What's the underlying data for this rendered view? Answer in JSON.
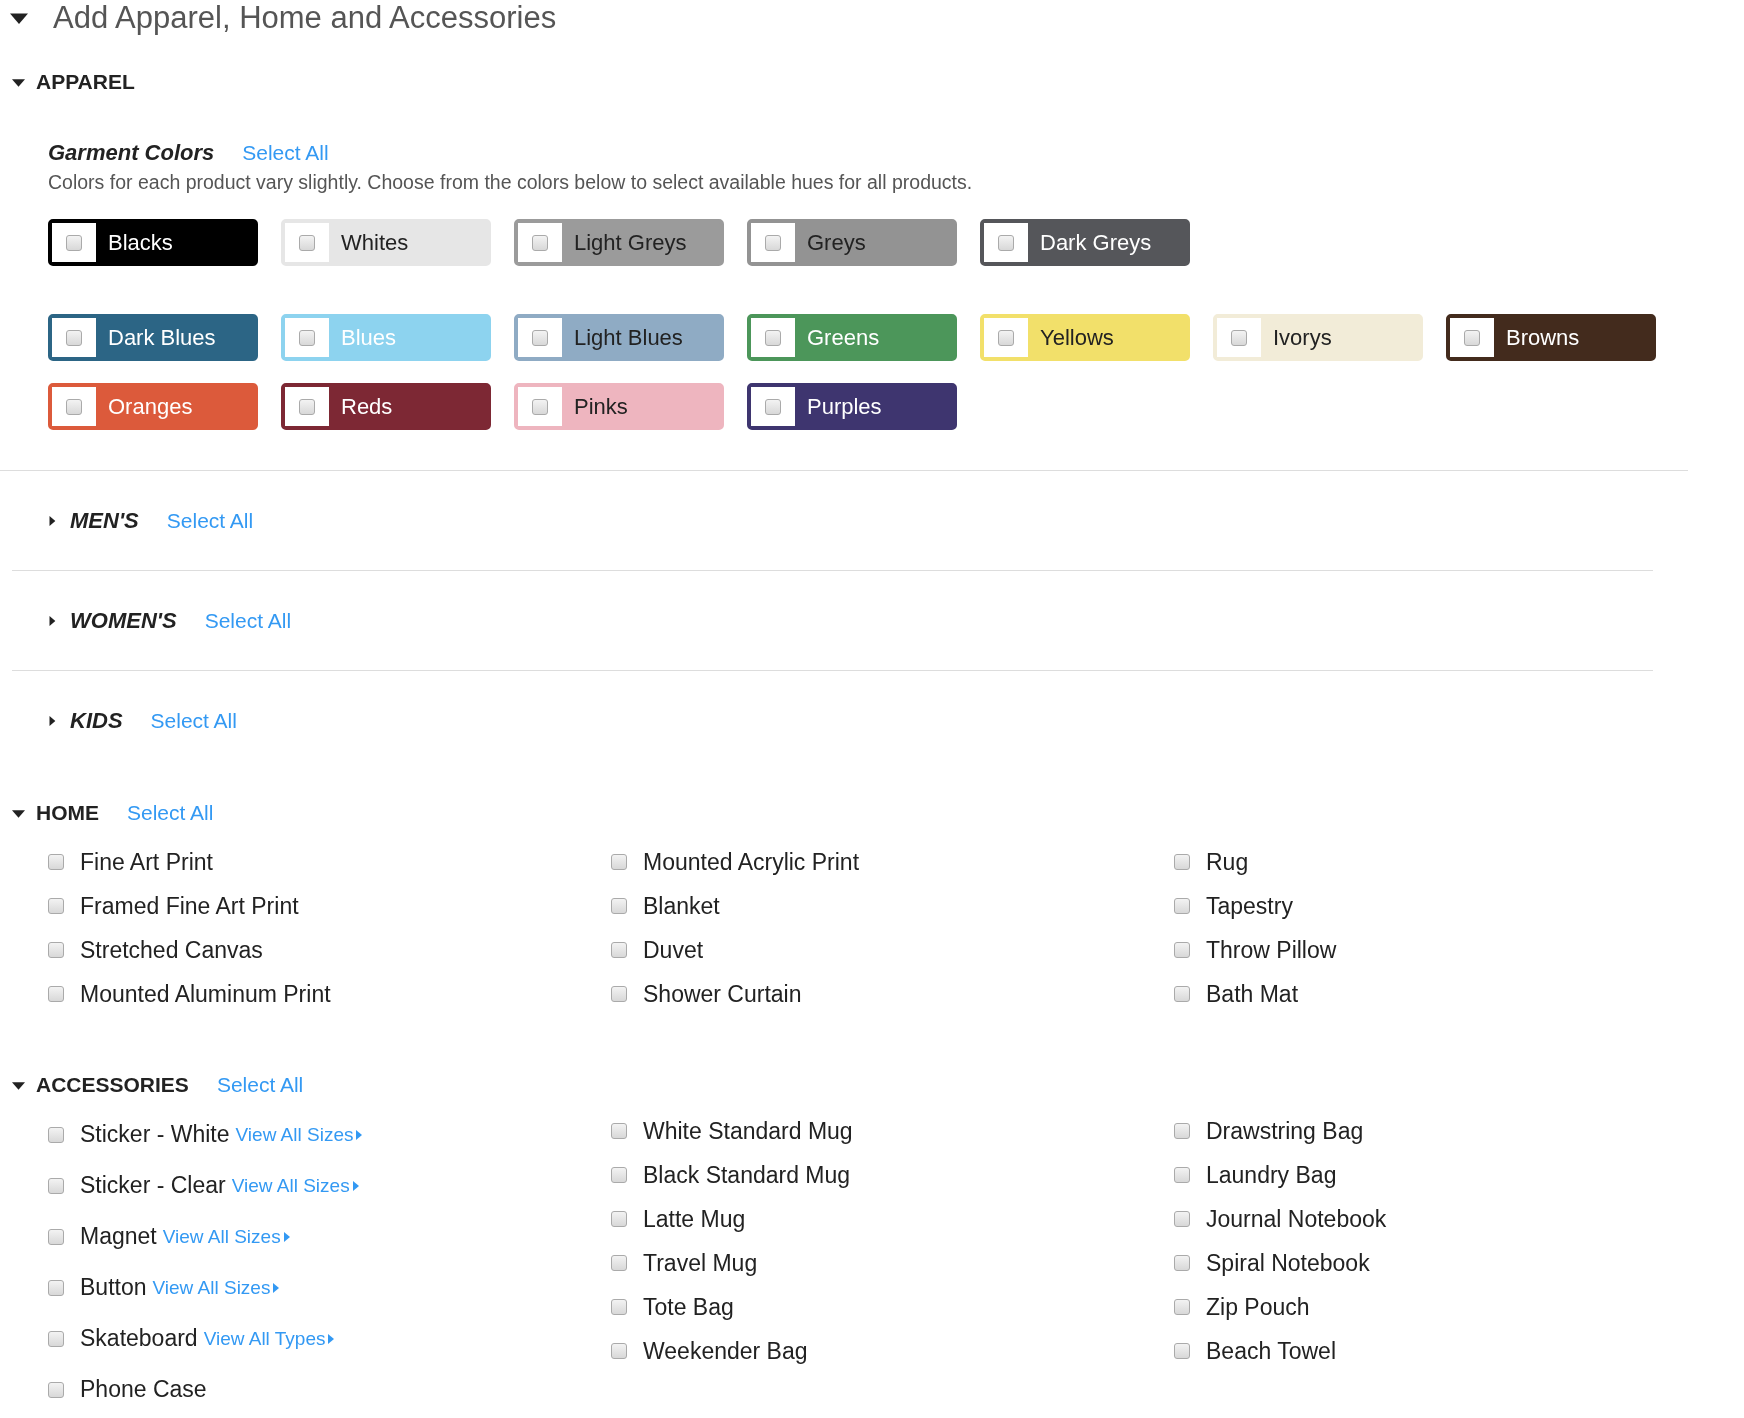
{
  "title": {
    "text": "Add Apparel, Home and Accessories",
    "expanded": true
  },
  "apparel": {
    "heading": "APPAREL",
    "expanded": true,
    "garment_colors": {
      "heading": "Garment Colors",
      "select_all": "Select All",
      "description": "Colors for each product vary slightly. Choose from the colors below to select available hues for all products.",
      "rows": [
        [
          {
            "label": "Blacks",
            "color": "#000000",
            "kind": "light",
            "checked": false
          },
          {
            "label": "Whites",
            "color": "#e6e6e6",
            "kind": "dark",
            "checked": false
          },
          {
            "label": "Light Greys",
            "color": "#9b9b9b",
            "kind": "dark",
            "checked": false
          },
          {
            "label": "Greys",
            "color": "#939393",
            "kind": "dark",
            "checked": false
          },
          {
            "label": "Dark Greys",
            "color": "#55565a",
            "kind": "light",
            "checked": false
          }
        ],
        [
          {
            "label": "Dark Blues",
            "color": "#2c6585",
            "kind": "light",
            "checked": false
          },
          {
            "label": "Blues",
            "color": "#8dd3ef",
            "kind": "light",
            "checked": false
          },
          {
            "label": "Light Blues",
            "color": "#8fabc4",
            "kind": "dark",
            "checked": false
          },
          {
            "label": "Greens",
            "color": "#4c965a",
            "kind": "light",
            "checked": false
          },
          {
            "label": "Yellows",
            "color": "#f2e06a",
            "kind": "dark",
            "checked": false
          },
          {
            "label": "Ivorys",
            "color": "#f2ecd8",
            "kind": "dark",
            "checked": false
          },
          {
            "label": "Browns",
            "color": "#432b1d",
            "kind": "light",
            "checked": false
          }
        ],
        [
          {
            "label": "Oranges",
            "color": "#dc5a3b",
            "kind": "light",
            "checked": false
          },
          {
            "label": "Reds",
            "color": "#7d2834",
            "kind": "light",
            "checked": false
          },
          {
            "label": "Pinks",
            "color": "#eeb5bf",
            "kind": "dark",
            "checked": false
          },
          {
            "label": "Purples",
            "color": "#3e356f",
            "kind": "light",
            "checked": false
          }
        ]
      ]
    },
    "subsections": [
      {
        "heading": "MEN'S",
        "select_all": "Select All",
        "expanded": false
      },
      {
        "heading": "WOMEN'S",
        "select_all": "Select All",
        "expanded": false
      },
      {
        "heading": "KIDS",
        "select_all": "Select All",
        "expanded": false
      }
    ]
  },
  "home": {
    "heading": "HOME",
    "select_all": "Select All",
    "expanded": true,
    "columns": [
      [
        {
          "label": "Fine Art Print",
          "checked": false
        },
        {
          "label": "Framed Fine Art Print",
          "checked": false
        },
        {
          "label": "Stretched Canvas",
          "checked": false
        },
        {
          "label": "Mounted Aluminum Print",
          "checked": false
        }
      ],
      [
        {
          "label": "Mounted Acrylic Print",
          "checked": false
        },
        {
          "label": "Blanket",
          "checked": false
        },
        {
          "label": "Duvet",
          "checked": false
        },
        {
          "label": "Shower Curtain",
          "checked": false
        }
      ],
      [
        {
          "label": "Rug",
          "checked": false
        },
        {
          "label": "Tapestry",
          "checked": false
        },
        {
          "label": "Throw Pillow",
          "checked": false
        },
        {
          "label": "Bath Mat",
          "checked": false
        }
      ]
    ]
  },
  "accessories": {
    "heading": "ACCESSORIES",
    "select_all": "Select All",
    "expanded": true,
    "columns": [
      [
        {
          "label": "Sticker - White",
          "link": "View All Sizes",
          "checked": false
        },
        {
          "label": "Sticker - Clear",
          "link": "View All Sizes",
          "checked": false
        },
        {
          "label": "Magnet",
          "link": "View All Sizes",
          "checked": false
        },
        {
          "label": "Button",
          "link": "View All Sizes",
          "checked": false
        },
        {
          "label": "Skateboard",
          "link": "View All Types",
          "checked": false
        },
        {
          "label": "Phone Case",
          "checked": false
        }
      ],
      [
        {
          "label": "White Standard Mug",
          "checked": false
        },
        {
          "label": "Black Standard Mug",
          "checked": false
        },
        {
          "label": "Latte Mug",
          "checked": false
        },
        {
          "label": "Travel Mug",
          "checked": false
        },
        {
          "label": "Tote Bag",
          "checked": false
        },
        {
          "label": "Weekender Bag",
          "checked": false
        }
      ],
      [
        {
          "label": "Drawstring Bag",
          "checked": false
        },
        {
          "label": "Laundry Bag",
          "checked": false
        },
        {
          "label": "Journal Notebook",
          "checked": false
        },
        {
          "label": "Spiral Notebook",
          "checked": false
        },
        {
          "label": "Zip Pouch",
          "checked": false
        },
        {
          "label": "Beach Towel",
          "checked": false
        }
      ]
    ]
  }
}
